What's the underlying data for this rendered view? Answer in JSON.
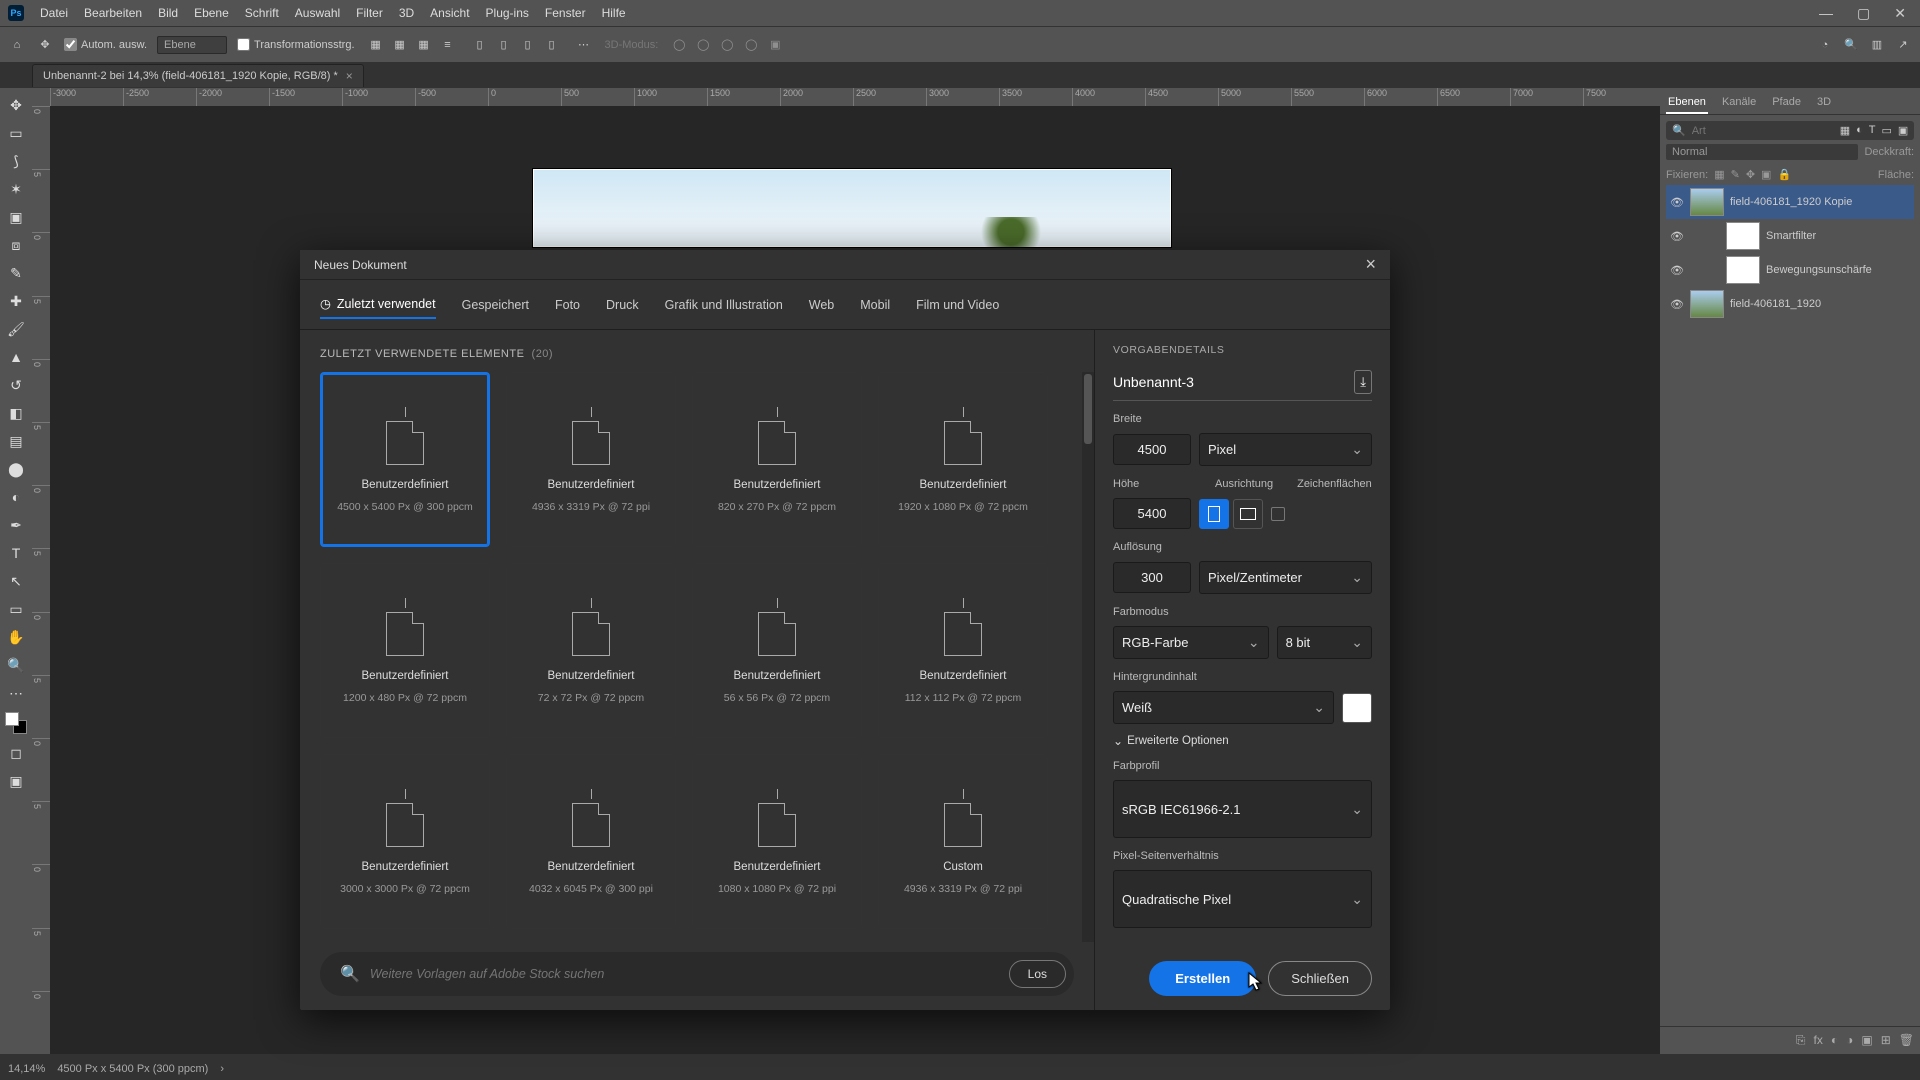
{
  "app": {
    "logo": "Ps"
  },
  "menu": [
    "Datei",
    "Bearbeiten",
    "Bild",
    "Ebene",
    "Schrift",
    "Auswahl",
    "Filter",
    "3D",
    "Ansicht",
    "Plug-ins",
    "Fenster",
    "Hilfe"
  ],
  "optionsbar": {
    "auto_select": "Autom. ausw.",
    "layer_select": "Ebene",
    "show_transform": "Transformationsstrg.",
    "mode3d": "3D-Modus:"
  },
  "doctab": {
    "title": "Unbenannt-2 bei 14,3% (field-406181_1920 Kopie, RGB/8) *"
  },
  "ruler_h": [
    "-3000",
    "-2500",
    "-2000",
    "-1500",
    "-1000",
    "-500",
    "0",
    "500",
    "1000",
    "1500",
    "2000",
    "2500",
    "3000",
    "3500",
    "4000",
    "4500",
    "5000",
    "5500",
    "6000",
    "6500",
    "7000",
    "7500"
  ],
  "ruler_v": [
    "0",
    "5",
    "0",
    "5",
    "0",
    "5",
    "0",
    "5",
    "0",
    "5",
    "0",
    "5",
    "0",
    "5",
    "0"
  ],
  "layers_panel": {
    "tabs": [
      "Ebenen",
      "Kanäle",
      "Pfade",
      "3D"
    ],
    "search_placeholder": "Art",
    "blend_mode": "Normal",
    "opacity_label": "Deckkraft:",
    "lock_label": "Fixieren:",
    "fill_label": "Fläche:",
    "layers": [
      {
        "name": "field-406181_1920 Kopie",
        "smart": true
      },
      {
        "name": "Smartfilter",
        "indent": true
      },
      {
        "name": "Bewegungsunschärfe",
        "indent": true
      },
      {
        "name": "field-406181_1920"
      }
    ]
  },
  "status": {
    "zoom": "14,14%",
    "info": "4500 Px x 5400 Px (300 ppcm)"
  },
  "dialog": {
    "title": "Neues Dokument",
    "tabs": [
      "Zuletzt verwendet",
      "Gespeichert",
      "Foto",
      "Druck",
      "Grafik und Illustration",
      "Web",
      "Mobil",
      "Film und Video"
    ],
    "heading": "ZULETZT VERWENDETE ELEMENTE",
    "count": "(20)",
    "presets": [
      {
        "name": "Benutzerdefiniert",
        "dim": "4500 x 5400 Px @ 300 ppcm",
        "selected": true
      },
      {
        "name": "Benutzerdefiniert",
        "dim": "4936 x 3319 Px @ 72 ppi"
      },
      {
        "name": "Benutzerdefiniert",
        "dim": "820 x 270 Px @ 72 ppcm"
      },
      {
        "name": "Benutzerdefiniert",
        "dim": "1920 x 1080 Px @ 72 ppcm"
      },
      {
        "name": "Benutzerdefiniert",
        "dim": "1200 x 480 Px @ 72 ppcm"
      },
      {
        "name": "Benutzerdefiniert",
        "dim": "72 x 72 Px @ 72 ppcm"
      },
      {
        "name": "Benutzerdefiniert",
        "dim": "56 x 56 Px @ 72 ppcm"
      },
      {
        "name": "Benutzerdefiniert",
        "dim": "112 x 112 Px @ 72 ppcm"
      },
      {
        "name": "Benutzerdefiniert",
        "dim": "3000 x 3000 Px @ 72 ppcm"
      },
      {
        "name": "Benutzerdefiniert",
        "dim": "4032 x 6045 Px @ 300 ppi"
      },
      {
        "name": "Benutzerdefiniert",
        "dim": "1080 x 1080 Px @ 72 ppi"
      },
      {
        "name": "Custom",
        "dim": "4936 x 3319 Px @ 72 ppi"
      }
    ],
    "search_placeholder": "Weitere Vorlagen auf Adobe Stock suchen",
    "search_go": "Los",
    "details": {
      "section": "VORGABENDETAILS",
      "name": "Unbenannt-3",
      "width_label": "Breite",
      "width": "4500",
      "unit": "Pixel",
      "height_label": "Höhe",
      "height": "5400",
      "orient_label": "Ausrichtung",
      "artboard_label": "Zeichenflächen",
      "res_label": "Auflösung",
      "res": "300",
      "res_unit": "Pixel/Zentimeter",
      "colormode_label": "Farbmodus",
      "colormode": "RGB-Farbe",
      "bits": "8 bit",
      "bg_label": "Hintergrundinhalt",
      "bg": "Weiß",
      "advanced": "Erweiterte Optionen",
      "profile_label": "Farbprofil",
      "profile": "sRGB IEC61966-2.1",
      "aspect_label": "Pixel-Seitenverhältnis",
      "aspect": "Quadratische Pixel"
    },
    "create": "Erstellen",
    "close": "Schließen"
  }
}
